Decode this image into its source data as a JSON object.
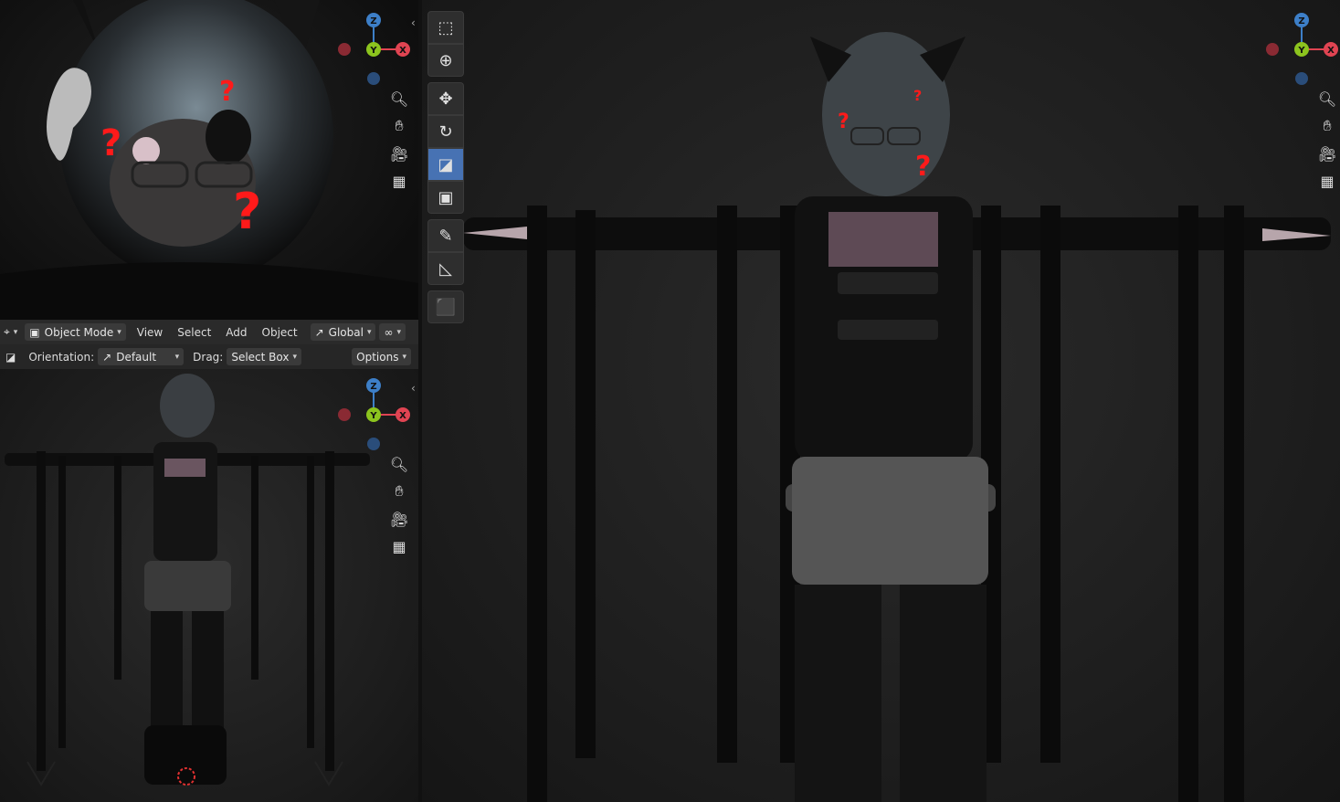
{
  "header": {
    "editor_type_icon": "editor-type-icon",
    "mode_label": "Object Mode",
    "menus": [
      "View",
      "Select",
      "Add",
      "Object"
    ],
    "transform_orientation": "Global"
  },
  "tool_settings": {
    "orientation_label": "Orientation:",
    "orientation_value": "Default",
    "drag_label": "Drag:",
    "drag_value": "Select Box",
    "options_label": "Options"
  },
  "gizmo": {
    "axes": {
      "x": "X",
      "y": "Y",
      "z": "Z"
    },
    "colors": {
      "x": "#e04452",
      "y": "#8cc41e",
      "z": "#3d7fc8"
    }
  },
  "toolbar": {
    "tools": [
      "select-box",
      "cursor",
      "move",
      "rotate",
      "scale",
      "transform",
      "annotate",
      "measure",
      "add-cube"
    ],
    "active_tool": "scale"
  },
  "colors": {
    "accent": "#4772b3",
    "header_bg": "#2a2a2a"
  }
}
